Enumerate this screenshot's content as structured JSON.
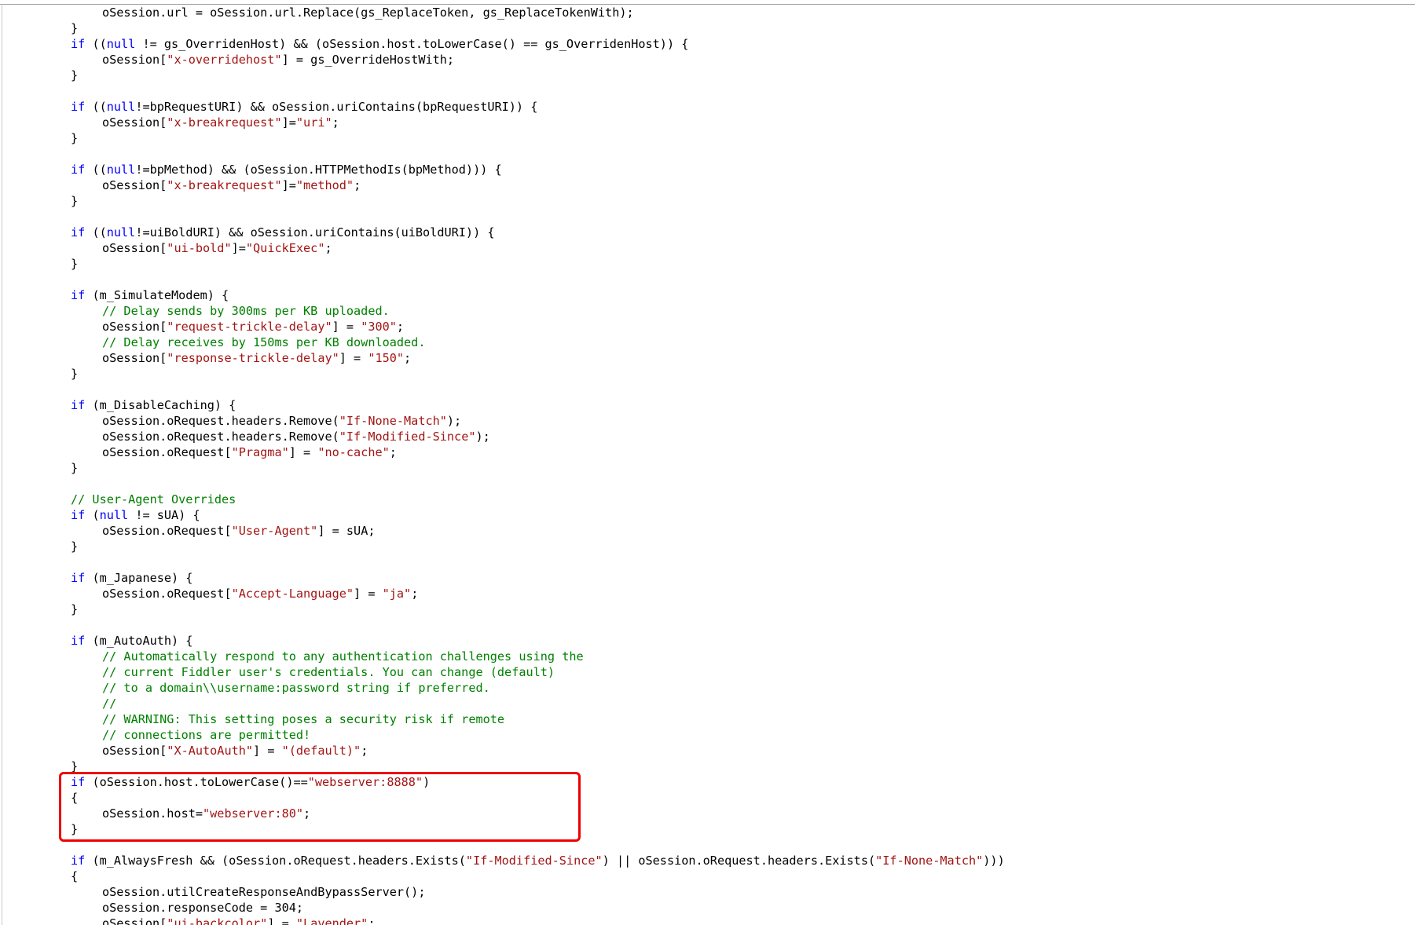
{
  "colors": {
    "background": "#ffffff",
    "keyword": "#0000ff",
    "string": "#a31515",
    "comment": "#008000",
    "plain": "#000000",
    "highlight_border": "#ee0000"
  },
  "code_lines": [
    {
      "indent": 2,
      "tokens": [
        {
          "t": "pl",
          "v": "oSession.url = oSession.url.Replace(gs_ReplaceToken, gs_ReplaceTokenWith);"
        }
      ]
    },
    {
      "indent": 1,
      "tokens": [
        {
          "t": "pl",
          "v": "}"
        }
      ]
    },
    {
      "indent": 1,
      "tokens": [
        {
          "t": "kw",
          "v": "if"
        },
        {
          "t": "pl",
          "v": " (("
        },
        {
          "t": "kw",
          "v": "null"
        },
        {
          "t": "pl",
          "v": " != gs_OverridenHost) && (oSession.host.toLowerCase() == gs_OverridenHost)) {"
        }
      ]
    },
    {
      "indent": 2,
      "tokens": [
        {
          "t": "pl",
          "v": "oSession["
        },
        {
          "t": "str",
          "v": "\"x-overridehost\""
        },
        {
          "t": "pl",
          "v": "] = gs_OverrideHostWith;"
        }
      ]
    },
    {
      "indent": 1,
      "tokens": [
        {
          "t": "pl",
          "v": "}"
        }
      ]
    },
    {
      "indent": 0,
      "tokens": []
    },
    {
      "indent": 1,
      "tokens": [
        {
          "t": "kw",
          "v": "if"
        },
        {
          "t": "pl",
          "v": " (("
        },
        {
          "t": "kw",
          "v": "null"
        },
        {
          "t": "pl",
          "v": "!=bpRequestURI) && oSession.uriContains(bpRequestURI)) {"
        }
      ]
    },
    {
      "indent": 2,
      "tokens": [
        {
          "t": "pl",
          "v": "oSession["
        },
        {
          "t": "str",
          "v": "\"x-breakrequest\""
        },
        {
          "t": "pl",
          "v": "]="
        },
        {
          "t": "str",
          "v": "\"uri\""
        },
        {
          "t": "pl",
          "v": ";"
        }
      ]
    },
    {
      "indent": 1,
      "tokens": [
        {
          "t": "pl",
          "v": "}"
        }
      ]
    },
    {
      "indent": 0,
      "tokens": []
    },
    {
      "indent": 1,
      "tokens": [
        {
          "t": "kw",
          "v": "if"
        },
        {
          "t": "pl",
          "v": " (("
        },
        {
          "t": "kw",
          "v": "null"
        },
        {
          "t": "pl",
          "v": "!=bpMethod) && (oSession.HTTPMethodIs(bpMethod))) {"
        }
      ]
    },
    {
      "indent": 2,
      "tokens": [
        {
          "t": "pl",
          "v": "oSession["
        },
        {
          "t": "str",
          "v": "\"x-breakrequest\""
        },
        {
          "t": "pl",
          "v": "]="
        },
        {
          "t": "str",
          "v": "\"method\""
        },
        {
          "t": "pl",
          "v": ";"
        }
      ]
    },
    {
      "indent": 1,
      "tokens": [
        {
          "t": "pl",
          "v": "}"
        }
      ]
    },
    {
      "indent": 0,
      "tokens": []
    },
    {
      "indent": 1,
      "tokens": [
        {
          "t": "kw",
          "v": "if"
        },
        {
          "t": "pl",
          "v": " (("
        },
        {
          "t": "kw",
          "v": "null"
        },
        {
          "t": "pl",
          "v": "!=uiBoldURI) && oSession.uriContains(uiBoldURI)) {"
        }
      ]
    },
    {
      "indent": 2,
      "tokens": [
        {
          "t": "pl",
          "v": "oSession["
        },
        {
          "t": "str",
          "v": "\"ui-bold\""
        },
        {
          "t": "pl",
          "v": "]="
        },
        {
          "t": "str",
          "v": "\"QuickExec\""
        },
        {
          "t": "pl",
          "v": ";"
        }
      ]
    },
    {
      "indent": 1,
      "tokens": [
        {
          "t": "pl",
          "v": "}"
        }
      ]
    },
    {
      "indent": 0,
      "tokens": []
    },
    {
      "indent": 1,
      "tokens": [
        {
          "t": "kw",
          "v": "if"
        },
        {
          "t": "pl",
          "v": " (m_SimulateModem) {"
        }
      ]
    },
    {
      "indent": 2,
      "tokens": [
        {
          "t": "cm",
          "v": "// Delay sends by 300ms per KB uploaded."
        }
      ]
    },
    {
      "indent": 2,
      "tokens": [
        {
          "t": "pl",
          "v": "oSession["
        },
        {
          "t": "str",
          "v": "\"request-trickle-delay\""
        },
        {
          "t": "pl",
          "v": "] = "
        },
        {
          "t": "str",
          "v": "\"300\""
        },
        {
          "t": "pl",
          "v": ";"
        }
      ]
    },
    {
      "indent": 2,
      "tokens": [
        {
          "t": "cm",
          "v": "// Delay receives by 150ms per KB downloaded."
        }
      ]
    },
    {
      "indent": 2,
      "tokens": [
        {
          "t": "pl",
          "v": "oSession["
        },
        {
          "t": "str",
          "v": "\"response-trickle-delay\""
        },
        {
          "t": "pl",
          "v": "] = "
        },
        {
          "t": "str",
          "v": "\"150\""
        },
        {
          "t": "pl",
          "v": ";"
        }
      ]
    },
    {
      "indent": 1,
      "tokens": [
        {
          "t": "pl",
          "v": "}"
        }
      ]
    },
    {
      "indent": 0,
      "tokens": []
    },
    {
      "indent": 1,
      "tokens": [
        {
          "t": "kw",
          "v": "if"
        },
        {
          "t": "pl",
          "v": " (m_DisableCaching) {"
        }
      ]
    },
    {
      "indent": 2,
      "tokens": [
        {
          "t": "pl",
          "v": "oSession.oRequest.headers.Remove("
        },
        {
          "t": "str",
          "v": "\"If-None-Match\""
        },
        {
          "t": "pl",
          "v": ");"
        }
      ]
    },
    {
      "indent": 2,
      "tokens": [
        {
          "t": "pl",
          "v": "oSession.oRequest.headers.Remove("
        },
        {
          "t": "str",
          "v": "\"If-Modified-Since\""
        },
        {
          "t": "pl",
          "v": ");"
        }
      ]
    },
    {
      "indent": 2,
      "tokens": [
        {
          "t": "pl",
          "v": "oSession.oRequest["
        },
        {
          "t": "str",
          "v": "\"Pragma\""
        },
        {
          "t": "pl",
          "v": "] = "
        },
        {
          "t": "str",
          "v": "\"no-cache\""
        },
        {
          "t": "pl",
          "v": ";"
        }
      ]
    },
    {
      "indent": 1,
      "tokens": [
        {
          "t": "pl",
          "v": "}"
        }
      ]
    },
    {
      "indent": 0,
      "tokens": []
    },
    {
      "indent": 1,
      "tokens": [
        {
          "t": "cm",
          "v": "// User-Agent Overrides"
        }
      ]
    },
    {
      "indent": 1,
      "tokens": [
        {
          "t": "kw",
          "v": "if"
        },
        {
          "t": "pl",
          "v": " ("
        },
        {
          "t": "kw",
          "v": "null"
        },
        {
          "t": "pl",
          "v": " != sUA) {"
        }
      ]
    },
    {
      "indent": 2,
      "tokens": [
        {
          "t": "pl",
          "v": "oSession.oRequest["
        },
        {
          "t": "str",
          "v": "\"User-Agent\""
        },
        {
          "t": "pl",
          "v": "] = sUA;"
        }
      ]
    },
    {
      "indent": 1,
      "tokens": [
        {
          "t": "pl",
          "v": "}"
        }
      ]
    },
    {
      "indent": 0,
      "tokens": []
    },
    {
      "indent": 1,
      "tokens": [
        {
          "t": "kw",
          "v": "if"
        },
        {
          "t": "pl",
          "v": " (m_Japanese) {"
        }
      ]
    },
    {
      "indent": 2,
      "tokens": [
        {
          "t": "pl",
          "v": "oSession.oRequest["
        },
        {
          "t": "str",
          "v": "\"Accept-Language\""
        },
        {
          "t": "pl",
          "v": "] = "
        },
        {
          "t": "str",
          "v": "\"ja\""
        },
        {
          "t": "pl",
          "v": ";"
        }
      ]
    },
    {
      "indent": 1,
      "tokens": [
        {
          "t": "pl",
          "v": "}"
        }
      ]
    },
    {
      "indent": 0,
      "tokens": []
    },
    {
      "indent": 1,
      "tokens": [
        {
          "t": "kw",
          "v": "if"
        },
        {
          "t": "pl",
          "v": " (m_AutoAuth) {"
        }
      ]
    },
    {
      "indent": 2,
      "tokens": [
        {
          "t": "cm",
          "v": "// Automatically respond to any authentication challenges using the"
        }
      ]
    },
    {
      "indent": 2,
      "tokens": [
        {
          "t": "cm",
          "v": "// current Fiddler user's credentials. You can change (default)"
        }
      ]
    },
    {
      "indent": 2,
      "tokens": [
        {
          "t": "cm",
          "v": "// to a domain\\\\username:password string if preferred."
        }
      ]
    },
    {
      "indent": 2,
      "tokens": [
        {
          "t": "cm",
          "v": "//"
        }
      ]
    },
    {
      "indent": 2,
      "tokens": [
        {
          "t": "cm",
          "v": "// WARNING: This setting poses a security risk if remote"
        }
      ]
    },
    {
      "indent": 2,
      "tokens": [
        {
          "t": "cm",
          "v": "// connections are permitted!"
        }
      ]
    },
    {
      "indent": 2,
      "tokens": [
        {
          "t": "pl",
          "v": "oSession["
        },
        {
          "t": "str",
          "v": "\"X-AutoAuth\""
        },
        {
          "t": "pl",
          "v": "] = "
        },
        {
          "t": "str",
          "v": "\"(default)\""
        },
        {
          "t": "pl",
          "v": ";"
        }
      ]
    },
    {
      "indent": 1,
      "tokens": [
        {
          "t": "pl",
          "v": "}"
        }
      ]
    },
    {
      "indent": 1,
      "tokens": [
        {
          "t": "kw",
          "v": "if"
        },
        {
          "t": "pl",
          "v": " (oSession.host.toLowerCase()=="
        },
        {
          "t": "str",
          "v": "\"webserver:8888\""
        },
        {
          "t": "pl",
          "v": ")"
        }
      ]
    },
    {
      "indent": 1,
      "tokens": [
        {
          "t": "pl",
          "v": "{"
        }
      ]
    },
    {
      "indent": 2,
      "tokens": [
        {
          "t": "pl",
          "v": "oSession.host="
        },
        {
          "t": "str",
          "v": "\"webserver:80\""
        },
        {
          "t": "pl",
          "v": ";"
        }
      ]
    },
    {
      "indent": 1,
      "tokens": [
        {
          "t": "pl",
          "v": "}"
        }
      ]
    },
    {
      "indent": 0,
      "tokens": []
    },
    {
      "indent": 1,
      "tokens": [
        {
          "t": "kw",
          "v": "if"
        },
        {
          "t": "pl",
          "v": " (m_AlwaysFresh && (oSession.oRequest.headers.Exists("
        },
        {
          "t": "str",
          "v": "\"If-Modified-Since\""
        },
        {
          "t": "pl",
          "v": ") || oSession.oRequest.headers.Exists("
        },
        {
          "t": "str",
          "v": "\"If-None-Match\""
        },
        {
          "t": "pl",
          "v": ")))"
        }
      ]
    },
    {
      "indent": 1,
      "tokens": [
        {
          "t": "pl",
          "v": "{"
        }
      ]
    },
    {
      "indent": 2,
      "tokens": [
        {
          "t": "pl",
          "v": "oSession.utilCreateResponseAndBypassServer();"
        }
      ]
    },
    {
      "indent": 2,
      "tokens": [
        {
          "t": "pl",
          "v": "oSession.responseCode = 304;"
        }
      ]
    },
    {
      "indent": 2,
      "tokens": [
        {
          "t": "pl",
          "v": "oSession["
        },
        {
          "t": "str",
          "v": "\"ui-backcolor\""
        },
        {
          "t": "pl",
          "v": "] = "
        },
        {
          "t": "str",
          "v": "\"Lavender\""
        },
        {
          "t": "pl",
          "v": ";"
        }
      ]
    }
  ]
}
